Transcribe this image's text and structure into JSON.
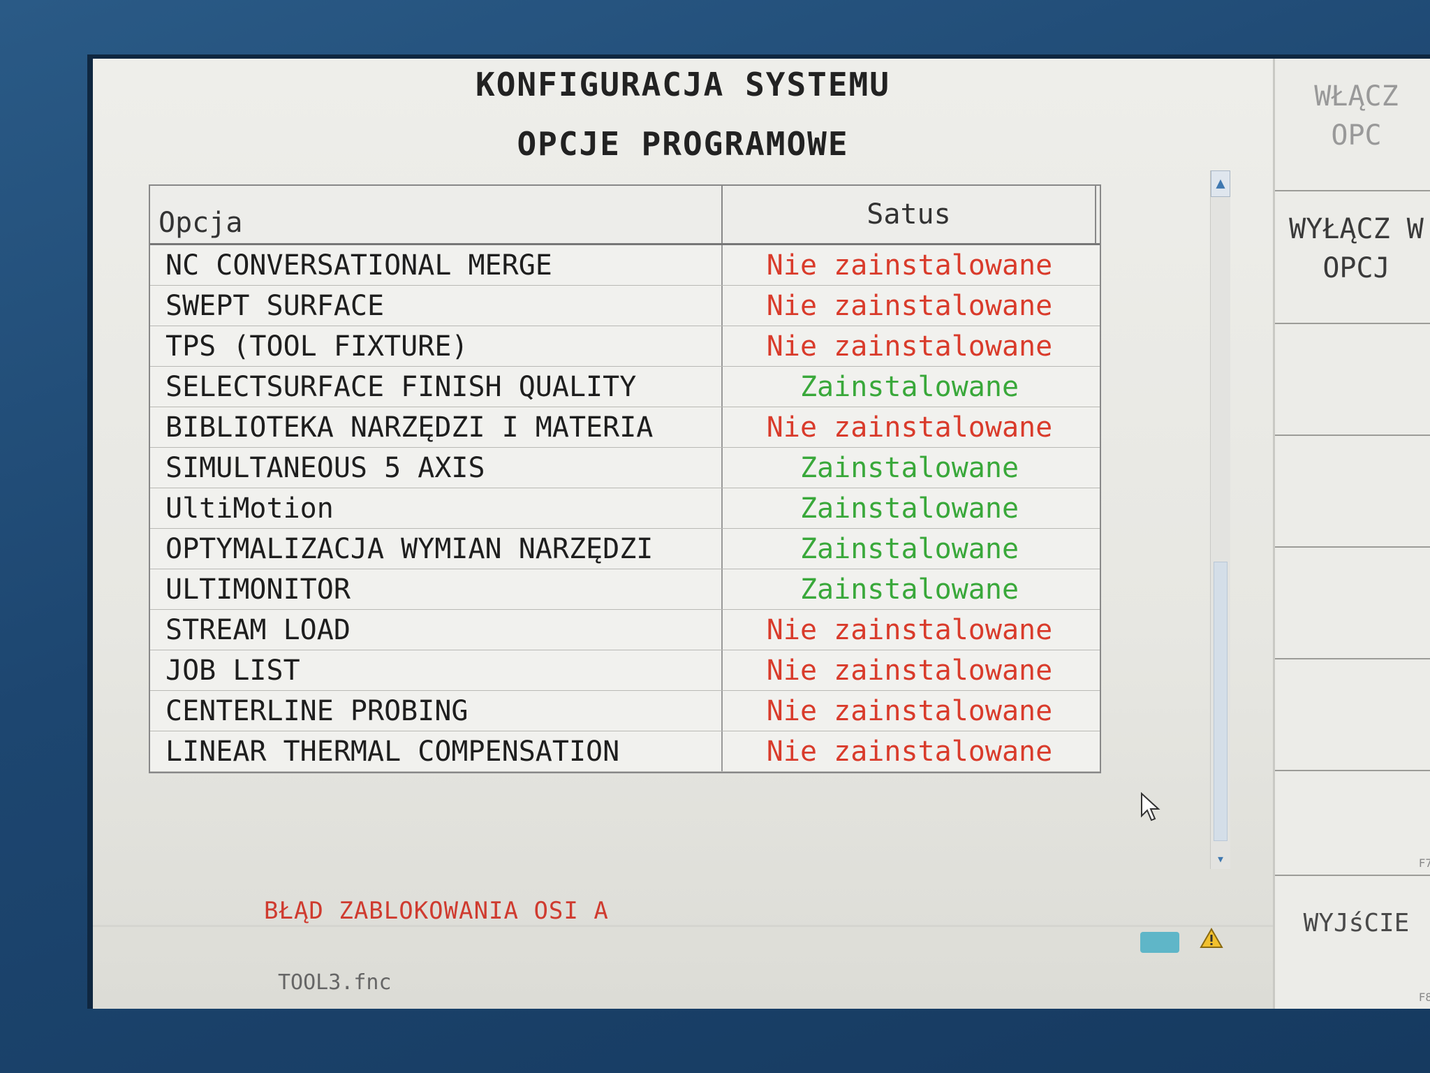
{
  "screen": {
    "title": "KONFIGURACJA SYSTEMU",
    "subtitle": "OPCJE PROGRAMOWE"
  },
  "table": {
    "headers": {
      "option": "Opcja",
      "status": "Satus"
    },
    "rows": [
      {
        "option": "NC CONVERSATIONAL MERGE",
        "status": "Nie zainstalowane",
        "installed": false
      },
      {
        "option": "SWEPT SURFACE",
        "status": "Nie zainstalowane",
        "installed": false
      },
      {
        "option": "TPS (TOOL FIXTURE)",
        "status": "Nie zainstalowane",
        "installed": false
      },
      {
        "option": "SELECTSURFACE FINISH QUALITY",
        "status": "Zainstalowane",
        "installed": true
      },
      {
        "option": "BIBLIOTEKA NARZĘDZI I MATERIA",
        "status": "Nie zainstalowane",
        "installed": false
      },
      {
        "option": "SIMULTANEOUS 5 AXIS",
        "status": "Zainstalowane",
        "installed": true
      },
      {
        "option": "UltiMotion",
        "status": "Zainstalowane",
        "installed": true
      },
      {
        "option": "OPTYMALIZACJA WYMIAN NARZĘDZI",
        "status": "Zainstalowane",
        "installed": true
      },
      {
        "option": "ULTIMONITOR",
        "status": "Zainstalowane",
        "installed": true
      },
      {
        "option": "STREAM LOAD",
        "status": "Nie zainstalowane",
        "installed": false
      },
      {
        "option": "JOB LIST",
        "status": "Nie zainstalowane",
        "installed": false
      },
      {
        "option": "CENTERLINE PROBING",
        "status": "Nie zainstalowane",
        "installed": false
      },
      {
        "option": "LINEAR THERMAL COMPENSATION",
        "status": "Nie zainstalowane",
        "installed": false
      }
    ]
  },
  "status_bar": {
    "error_message": "BŁĄD ZABLOKOWANIA OSI A",
    "filename": "TOOL3.fnc"
  },
  "softkeys": {
    "enable_line1": "WŁĄCZ",
    "enable_line2": "OPC",
    "disable_line1": "WYŁĄCZ W",
    "disable_line2": "OPCJ",
    "exit": "WYJśCIE",
    "f7": "F7",
    "f8": "F8"
  },
  "colors": {
    "not_installed": "#d93b2b",
    "installed": "#39a83a",
    "error": "#cf3b2f",
    "bezel": "#1f4a72"
  },
  "icons": [
    "scroll-up-arrow-icon",
    "scroll-down-arrow-icon",
    "mouse-pointer-icon",
    "keyboard-icon",
    "warning-icon"
  ]
}
